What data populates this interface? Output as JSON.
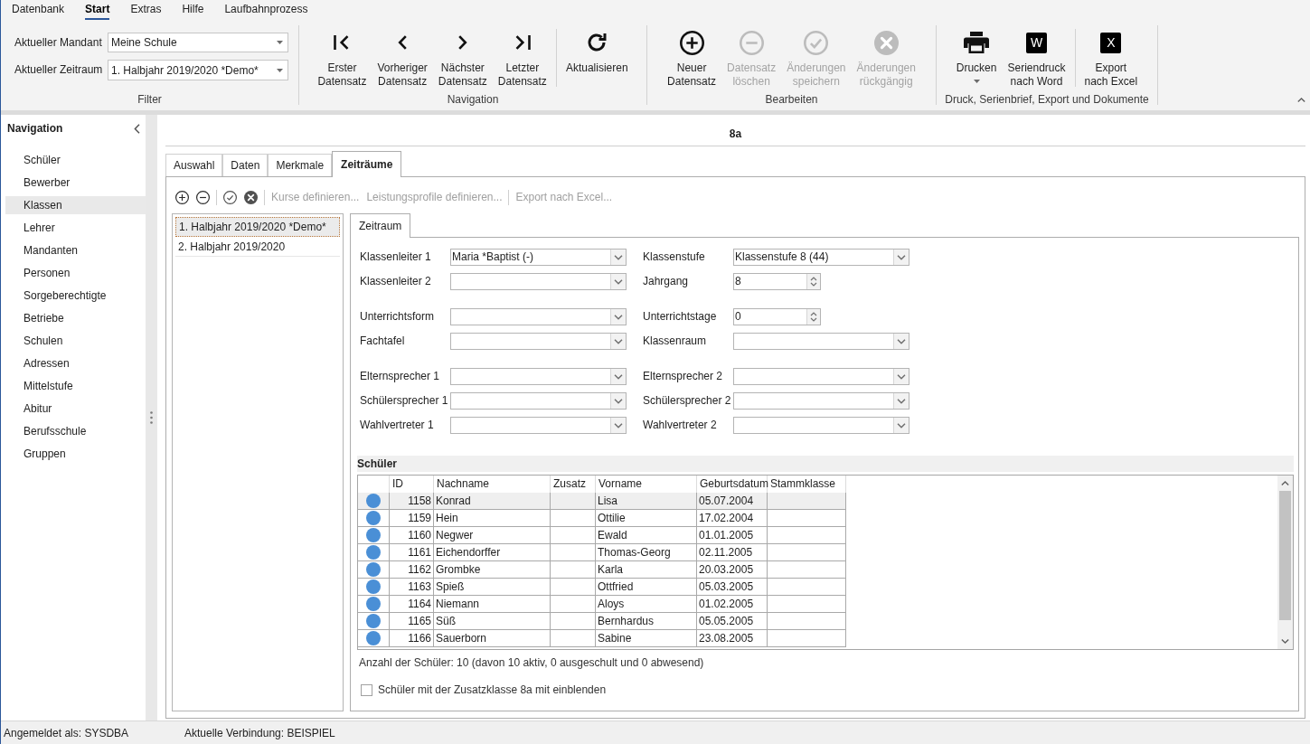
{
  "menu": {
    "tabs": [
      {
        "label": "Datenbank",
        "selected": false
      },
      {
        "label": "Start",
        "selected": true
      },
      {
        "label": "Extras",
        "selected": false
      },
      {
        "label": "Hilfe",
        "selected": false
      },
      {
        "label": "Laufbahnprozess",
        "selected": false
      }
    ]
  },
  "ribbon": {
    "groups": [
      {
        "kind": "filter",
        "label": "Filter",
        "fields": [
          {
            "label": "Aktueller Mandant",
            "value": "Meine Schule"
          },
          {
            "label": "Aktueller Zeitraum",
            "value": "1. Halbjahr 2019/2020 *Demo*"
          }
        ]
      },
      {
        "kind": "buttons",
        "label": "Navigation",
        "sections": [
          [
            {
              "kind": "first",
              "lines": [
                "Erster",
                "Datensatz"
              ],
              "disabled": false,
              "has_menu": false
            },
            {
              "kind": "previous",
              "lines": [
                "Vorheriger",
                "Datensatz"
              ],
              "disabled": false,
              "has_menu": false
            },
            {
              "kind": "next",
              "lines": [
                "Nächster",
                "Datensatz"
              ],
              "disabled": false,
              "has_menu": false
            },
            {
              "kind": "last",
              "lines": [
                "Letzter",
                "Datensatz"
              ],
              "disabled": false,
              "has_menu": false
            }
          ],
          [
            {
              "kind": "refresh",
              "lines": [
                "Aktualisieren"
              ],
              "disabled": false,
              "has_menu": false
            }
          ]
        ]
      },
      {
        "kind": "buttons",
        "label": "Bearbeiten",
        "sections": [
          [
            {
              "kind": "new",
              "lines": [
                "Neuer",
                "Datensatz"
              ],
              "disabled": false,
              "has_menu": false
            },
            {
              "kind": "delete",
              "lines": [
                "Datensatz",
                "löschen"
              ],
              "disabled": true,
              "has_menu": false
            },
            {
              "kind": "save",
              "lines": [
                "Änderungen",
                "speichern"
              ],
              "disabled": true,
              "has_menu": false
            },
            {
              "kind": "undo",
              "lines": [
                "Änderungen",
                "rückgängig"
              ],
              "disabled": true,
              "has_menu": false
            }
          ]
        ]
      },
      {
        "kind": "buttons",
        "label": "Druck, Serienbrief, Export und Dokumente",
        "sections": [
          [
            {
              "kind": "print",
              "lines": [
                "Drucken"
              ],
              "disabled": false,
              "has_menu": true
            },
            {
              "kind": "tile",
              "tile": "W",
              "lines": [
                "Seriendruck",
                "nach Word"
              ],
              "disabled": false,
              "has_menu": false
            }
          ],
          [
            {
              "kind": "tile",
              "tile": "X",
              "lines": [
                "Export",
                "nach Excel"
              ],
              "disabled": false,
              "has_menu": false
            }
          ]
        ]
      }
    ]
  },
  "sidebar": {
    "title": "Navigation",
    "items": [
      {
        "label": "Schüler",
        "selected": false
      },
      {
        "label": "Bewerber",
        "selected": false
      },
      {
        "label": "Klassen",
        "selected": true
      },
      {
        "label": "Lehrer",
        "selected": false
      },
      {
        "label": "Mandanten",
        "selected": false
      },
      {
        "label": "Personen",
        "selected": false
      },
      {
        "label": "Sorgeberechtigte",
        "selected": false
      },
      {
        "label": "Betriebe",
        "selected": false
      },
      {
        "label": "Schulen",
        "selected": false
      },
      {
        "label": "Adressen",
        "selected": false
      },
      {
        "label": "Mittelstufe",
        "selected": false
      },
      {
        "label": "Abitur",
        "selected": false
      },
      {
        "label": "Berufsschule",
        "selected": false
      },
      {
        "label": "Gruppen",
        "selected": false
      }
    ]
  },
  "main": {
    "title": "8a",
    "tabs": [
      {
        "label": "Auswahl",
        "selected": false
      },
      {
        "label": "Daten",
        "selected": false
      },
      {
        "label": "Merkmale",
        "selected": false
      },
      {
        "label": "Zeiträume",
        "selected": true
      }
    ],
    "toolbar": {
      "sections": [
        [
          {
            "kind": "add"
          },
          {
            "kind": "remove"
          }
        ],
        [
          {
            "kind": "confirm"
          },
          {
            "kind": "cancel"
          }
        ],
        [
          {
            "kind": "link",
            "label": "Kurse definieren...",
            "disabled": true
          },
          {
            "kind": "link",
            "label": "Leistungsprofile definieren...",
            "disabled": true
          }
        ],
        [
          {
            "kind": "link",
            "label": "Export nach Excel...",
            "disabled": true
          }
        ]
      ]
    },
    "periods": [
      {
        "label": "1. Halbjahr 2019/2020 *Demo*",
        "selected": true
      },
      {
        "label": "2. Halbjahr 2019/2020",
        "selected": false
      }
    ],
    "detail_tabs": [
      {
        "label": "Zeitraum",
        "selected": true
      }
    ],
    "form_groups": [
      [
        [
          {
            "label": "Klassenleiter 1",
            "kind": "combo",
            "value": "Maria *Baptist (-)"
          },
          {
            "label": "Klassenstufe",
            "kind": "combo",
            "value": "Klassenstufe 8 (44)"
          }
        ],
        [
          {
            "label": "Klassenleiter 2",
            "kind": "combo"
          },
          {
            "label": "Jahrgang",
            "kind": "spin",
            "value": "8"
          }
        ]
      ],
      [
        [
          {
            "label": "Unterrichtsform",
            "kind": "combo"
          },
          {
            "label": "Unterrichtstage",
            "kind": "spin",
            "value": "0"
          }
        ],
        [
          {
            "label": "Fachtafel",
            "kind": "combo"
          },
          {
            "label": "Klassenraum",
            "kind": "combo"
          }
        ]
      ],
      [
        [
          {
            "label": "Elternsprecher 1",
            "kind": "combo"
          },
          {
            "label": "Elternsprecher 2",
            "kind": "combo"
          }
        ],
        [
          {
            "label": "Schülersprecher 1",
            "kind": "combo"
          },
          {
            "label": "Schülersprecher 2",
            "kind": "combo"
          }
        ],
        [
          {
            "label": "Wahlvertreter 1",
            "kind": "combo"
          },
          {
            "label": "Wahlvertreter 2",
            "kind": "combo"
          }
        ]
      ]
    ],
    "students": {
      "title": "Schüler",
      "columns": [
        "ID",
        "Nachname",
        "Zusatz",
        "Vorname",
        "Geburtsdatum",
        "Stammklasse"
      ],
      "rows": [
        {
          "selected": true,
          "id": "1158",
          "last_name": "Konrad",
          "first_name": "Lisa",
          "birth_date": "05.07.2004"
        },
        {
          "selected": false,
          "id": "1159",
          "last_name": "Hein",
          "first_name": "Ottilie",
          "birth_date": "17.02.2004"
        },
        {
          "selected": false,
          "id": "1160",
          "last_name": "Negwer",
          "first_name": "Ewald",
          "birth_date": "01.01.2005"
        },
        {
          "selected": false,
          "id": "1161",
          "last_name": "Eichendorffer",
          "first_name": "Thomas-Georg",
          "birth_date": "02.11.2005"
        },
        {
          "selected": false,
          "id": "1162",
          "last_name": "Grombke",
          "first_name": "Karla",
          "birth_date": "20.03.2005"
        },
        {
          "selected": false,
          "id": "1163",
          "last_name": "Spieß",
          "first_name": "Ottfried",
          "birth_date": "05.03.2005"
        },
        {
          "selected": false,
          "id": "1164",
          "last_name": "Niemann",
          "first_name": "Aloys",
          "birth_date": "01.02.2005"
        },
        {
          "selected": false,
          "id": "1165",
          "last_name": "Süß",
          "first_name": "Bernhardus",
          "birth_date": "05.05.2005"
        },
        {
          "selected": false,
          "id": "1166",
          "last_name": "Sauerborn",
          "first_name": "Sabine",
          "birth_date": "23.08.2005"
        }
      ],
      "summary": "Anzahl der Schüler: 10 (davon 10 aktiv, 0 ausgeschult und 0 abwesend)",
      "include_option": {
        "label": "Schüler mit der Zusatzklasse 8a mit einblenden",
        "checked": false
      }
    }
  },
  "status_bar": {
    "items": [
      "Angemeldet als: SYSDBA",
      "Aktuelle Verbindung: BEISPIEL"
    ]
  }
}
